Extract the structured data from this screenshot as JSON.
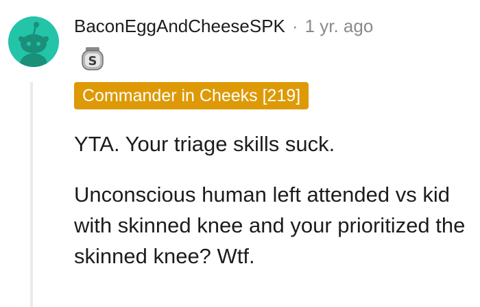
{
  "comment": {
    "username": "BaconEggAndCheeseSPK",
    "separator": "·",
    "timestamp": "1 yr. ago",
    "award_icon": "silver-award-icon",
    "flair": "Commander in Cheeks [219]",
    "flair_color": "#dd9a06",
    "avatar_color": "#23c4a8",
    "paragraphs": [
      "YTA. Your triage skills suck.",
      "Unconscious human left attended vs kid with skinned knee and your prioritized the skinned knee? Wtf."
    ]
  }
}
